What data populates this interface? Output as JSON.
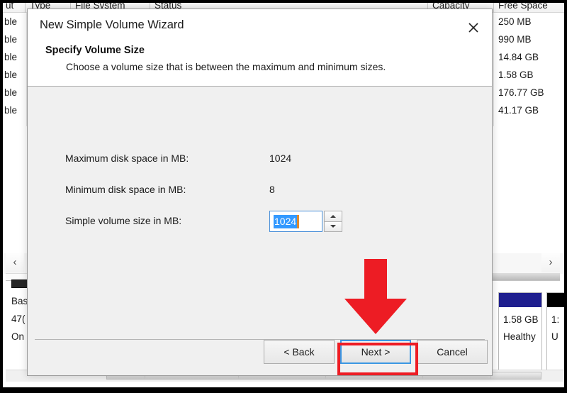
{
  "background": {
    "app": "Disk Management",
    "list_headers": [
      "ut",
      "Type",
      "File System",
      "Status",
      "Capacity",
      "Free Space"
    ],
    "left_column_cells": [
      "ble",
      "ble",
      "ble",
      "ble",
      "ble",
      "ble"
    ],
    "free_space_column": [
      "250 MB",
      "990 MB",
      "14.84 GB",
      "1.58 GB",
      "176.77 GB",
      "41.17 GB"
    ],
    "scroll_left_icon": "chevron-left-icon",
    "scroll_right_icon": "chevron-right-icon",
    "disk": {
      "name": "Bas",
      "capacity": "47(",
      "status": "On"
    },
    "partitions": [
      {
        "bar_color": "#1f1f8f",
        "capacity": "1.58 GB",
        "status": "Healthy"
      },
      {
        "bar_color": "#000000",
        "capacity": "1:",
        "status": "U"
      }
    ]
  },
  "dialog": {
    "title": "New Simple Volume Wizard",
    "close_icon": "close-icon",
    "subtitle": "Specify Volume Size",
    "description": "Choose a volume size that is between the maximum and minimum sizes.",
    "fields": [
      {
        "label": "Maximum disk space in MB:",
        "value": "1024"
      },
      {
        "label": "Minimum disk space in MB:",
        "value": "8"
      },
      {
        "label": "Simple volume size in MB:",
        "value": "1024"
      }
    ],
    "spinner": {
      "value": "1024",
      "selected": true,
      "up_icon": "caret-up-icon",
      "down_icon": "caret-down-icon"
    },
    "buttons": {
      "back": "< Back",
      "next": "Next >",
      "cancel": "Cancel"
    }
  },
  "annotation": {
    "arrow_icon": "red-down-arrow-icon",
    "arrow_color": "#ed1c24",
    "highlight_color": "#ed1c24",
    "highlight_target": "Next >"
  },
  "colors": {
    "dialog_body": "#f0f0f0",
    "dialog_header": "#ffffff",
    "focus_blue": "#3b97e3",
    "selection_blue": "#3399ff",
    "caret_orange": "#e08a2e",
    "annotation_red": "#ed1c24"
  }
}
